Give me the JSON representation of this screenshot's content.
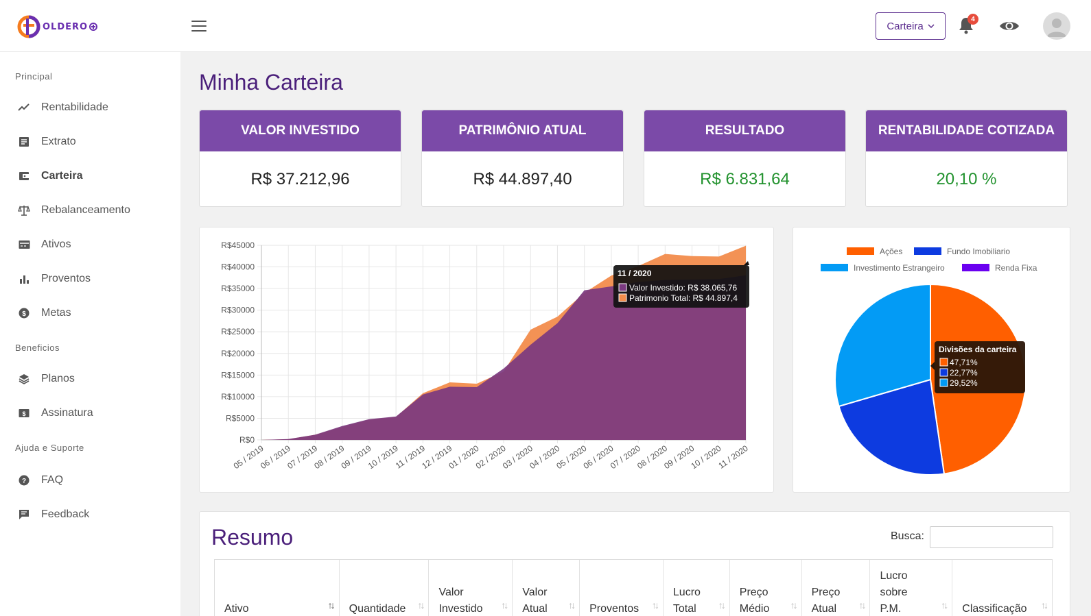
{
  "header": {
    "logo_text": "OLDERO",
    "wallet_button": "Carteira",
    "notification_count": "4"
  },
  "sidebar": {
    "sections": [
      {
        "title": "Principal"
      },
      {
        "title": "Beneficios"
      },
      {
        "title": "Ajuda e Suporte"
      }
    ],
    "items": [
      {
        "label": "Rentabilidade",
        "icon": "trending-up-icon"
      },
      {
        "label": "Extrato",
        "icon": "receipt-icon"
      },
      {
        "label": "Carteira",
        "icon": "wallet-icon",
        "active": true
      },
      {
        "label": "Rebalanceamento",
        "icon": "scale-icon"
      },
      {
        "label": "Ativos",
        "icon": "card-icon"
      },
      {
        "label": "Proventos",
        "icon": "bar-chart-icon"
      },
      {
        "label": "Metas",
        "icon": "dollar-circle-icon"
      },
      {
        "label": "Planos",
        "icon": "layers-icon"
      },
      {
        "label": "Assinatura",
        "icon": "money-icon"
      },
      {
        "label": "FAQ",
        "icon": "help-icon"
      },
      {
        "label": "Feedback",
        "icon": "feedback-icon"
      }
    ]
  },
  "main": {
    "title": "Minha Carteira",
    "cards": [
      {
        "title": "VALOR INVESTIDO",
        "value": "R$ 37.212,96",
        "color": "#222222"
      },
      {
        "title": "PATRIMÔNIO ATUAL",
        "value": "R$ 44.897,40",
        "color": "#222222"
      },
      {
        "title": "RESULTADO",
        "value": "R$ 6.831,64",
        "color": "#22922e"
      },
      {
        "title": "RENTABILIDADE COTIZADA",
        "value": "20,10 %",
        "color": "#22922e"
      }
    ]
  },
  "colors": {
    "primary": "#7b4aa8",
    "title": "#4a1f7a",
    "positive": "#22922e",
    "invested_area": "#7b3a80",
    "total_area": "#f28c4c"
  },
  "chart_data": [
    {
      "type": "area",
      "x": [
        "05 / 2019",
        "06 / 2019",
        "07 / 2019",
        "08 / 2019",
        "09 / 2019",
        "10 / 2019",
        "11 / 2019",
        "12 / 2019",
        "01 / 2020",
        "02 / 2020",
        "03 / 2020",
        "04 / 2020",
        "05 / 2020",
        "06 / 2020",
        "07 / 2020",
        "08 / 2020",
        "09 / 2020",
        "10 / 2020",
        "11 / 2020"
      ],
      "y_ticks": [
        "R$0",
        "R$5000",
        "R$10000",
        "R$15000",
        "R$20000",
        "R$25000",
        "R$30000",
        "R$35000",
        "R$40000",
        "R$45000"
      ],
      "ylim": [
        0,
        45000
      ],
      "series": [
        {
          "name": "Valor Investido",
          "values": [
            0,
            200,
            1200,
            3200,
            4800,
            5400,
            10500,
            12300,
            12200,
            16500,
            22000,
            27000,
            34600,
            35500,
            36500,
            37000,
            37100,
            37200,
            38065.76
          ]
        },
        {
          "name": "Patrimonio Total",
          "values": [
            0,
            150,
            1200,
            3000,
            4700,
            5300,
            10800,
            13300,
            13000,
            15800,
            25500,
            28500,
            34000,
            38000,
            40200,
            43000,
            42500,
            42400,
            44897.4
          ]
        }
      ],
      "tooltip": {
        "title": "11 / 2020",
        "lines": [
          "Valor Investido: R$ 38.065,76",
          "Patrimonio Total: R$ 44.897,4"
        ]
      },
      "grid": true
    },
    {
      "type": "pie",
      "legend": [
        "Ações",
        "Fundo Imobiliario",
        "Investimento Estrangeiro",
        "Renda Fixa"
      ],
      "legend_position": "top",
      "colors": [
        "#ff5f00",
        "#0d3be0",
        "#039bf5",
        "#6a00f0"
      ],
      "values": [
        47.71,
        22.77,
        29.52,
        0
      ],
      "tooltip": {
        "title": "Divisões da carteira",
        "lines": [
          "47,71%",
          "22,77%",
          "29,52%"
        ]
      }
    }
  ],
  "resumo": {
    "title": "Resumo",
    "search_label": "Busca:",
    "columns": [
      "Ativo",
      "Quantidade",
      "Valor\nInvestido",
      "Valor\nAtual",
      "Proventos",
      "Lucro\nTotal",
      "Preço\nMédio",
      "Preço\nAtual",
      "Lucro\nsobre\nP.M.",
      "Classificação"
    ]
  }
}
